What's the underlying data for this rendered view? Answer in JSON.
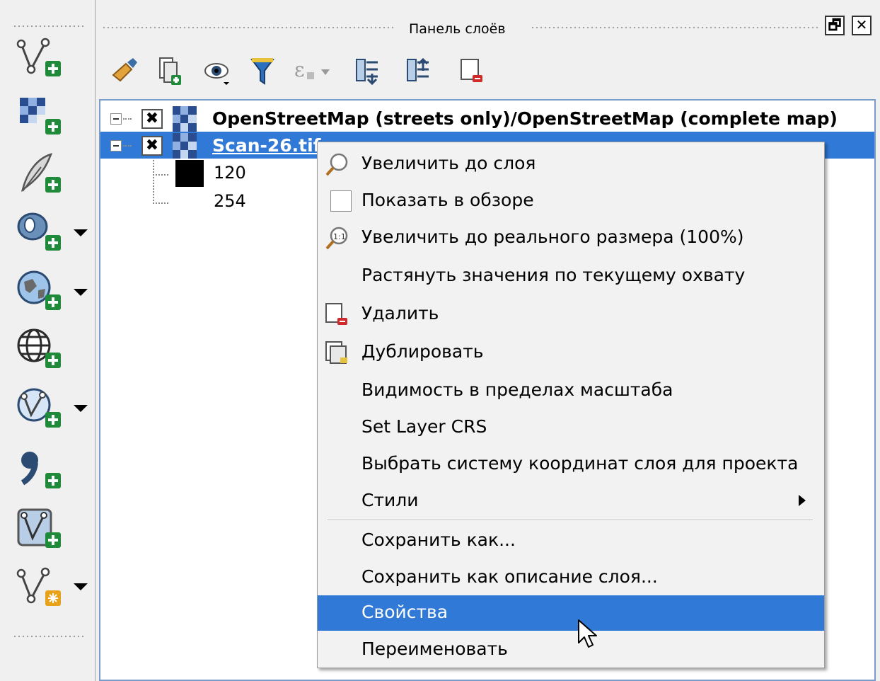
{
  "panel": {
    "title": "Панель слоёв",
    "float_button": "🗗",
    "close_button": "✕"
  },
  "left_toolbar": {
    "tools": [
      {
        "icon": "new-vector-layer-icon",
        "has_dropdown": false
      },
      {
        "icon": "add-raster-layer-icon",
        "has_dropdown": false
      },
      {
        "icon": "add-delimited-text-layer-icon",
        "has_dropdown": false
      },
      {
        "icon": "add-postgis-layer-icon",
        "has_dropdown": true
      },
      {
        "icon": "add-wms-layer-icon",
        "has_dropdown": true
      },
      {
        "icon": "add-wcs-layer-icon",
        "has_dropdown": false
      },
      {
        "icon": "add-wfs-layer-icon",
        "has_dropdown": true
      },
      {
        "icon": "add-virtual-layer-icon",
        "has_dropdown": false
      },
      {
        "icon": "add-spatialite-layer-icon",
        "has_dropdown": false
      },
      {
        "icon": "new-temporary-layer-icon",
        "has_dropdown": true
      }
    ]
  },
  "layer_toolbar": {
    "icons": [
      "style-brush-icon",
      "add-group-icon",
      "visibility-eye-icon",
      "filter-funnel-icon",
      "expression-filter-icon",
      "expand-all-icon",
      "collapse-all-icon",
      "remove-layer-icon"
    ]
  },
  "layer_tree": {
    "layers": [
      {
        "name": "OpenStreetMap (streets only)/OpenStreetMap (complete map)",
        "checked": "✖",
        "selected": false
      },
      {
        "name": "Scan-26.tif",
        "checked": "✖",
        "selected": true
      }
    ],
    "legend": [
      {
        "value": "120",
        "color": "#000000"
      },
      {
        "value": "254",
        "color": "#ffffff"
      }
    ]
  },
  "context_menu": {
    "items": [
      {
        "label": "Увеличить до слоя",
        "icon": "zoom-to-layer-icon"
      },
      {
        "label": "Показать в обзоре",
        "icon": "show-in-overview-checkbox"
      },
      {
        "label": "Увеличить до реального размера (100%)",
        "icon": "zoom-actual-size-icon"
      },
      {
        "label": "Растянуть значения по текущему охвату",
        "icon": ""
      },
      {
        "label": "Удалить",
        "icon": "remove-layer-icon"
      },
      {
        "label": "Дублировать",
        "icon": "duplicate-layer-icon"
      },
      {
        "label": "Видимость в пределах масштаба",
        "icon": ""
      },
      {
        "label": "Set Layer CRS",
        "icon": ""
      },
      {
        "label": "Выбрать систему координат слоя для проекта",
        "icon": ""
      },
      {
        "label": "Стили",
        "icon": "",
        "submenu": true
      },
      {
        "label": "Сохранить как...",
        "icon": ""
      },
      {
        "label": "Сохранить как описание слоя...",
        "icon": ""
      },
      {
        "label": "Свойства",
        "icon": "",
        "highlighted": true
      },
      {
        "label": "Переименовать",
        "icon": ""
      }
    ]
  },
  "colors": {
    "selection": "#3079d6",
    "panel_bg": "#f0f0f0",
    "menu_bg": "#f2f2f2"
  }
}
